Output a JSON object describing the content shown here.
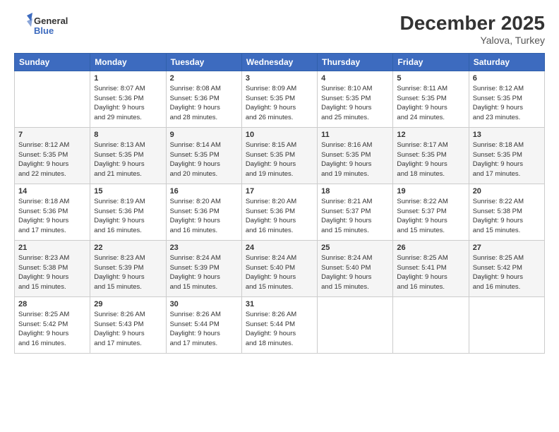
{
  "header": {
    "logo_line1": "General",
    "logo_line2": "Blue",
    "month_title": "December 2025",
    "location": "Yalova, Turkey"
  },
  "weekdays": [
    "Sunday",
    "Monday",
    "Tuesday",
    "Wednesday",
    "Thursday",
    "Friday",
    "Saturday"
  ],
  "weeks": [
    [
      {
        "day": "",
        "info": ""
      },
      {
        "day": "1",
        "info": "Sunrise: 8:07 AM\nSunset: 5:36 PM\nDaylight: 9 hours\nand 29 minutes."
      },
      {
        "day": "2",
        "info": "Sunrise: 8:08 AM\nSunset: 5:36 PM\nDaylight: 9 hours\nand 28 minutes."
      },
      {
        "day": "3",
        "info": "Sunrise: 8:09 AM\nSunset: 5:35 PM\nDaylight: 9 hours\nand 26 minutes."
      },
      {
        "day": "4",
        "info": "Sunrise: 8:10 AM\nSunset: 5:35 PM\nDaylight: 9 hours\nand 25 minutes."
      },
      {
        "day": "5",
        "info": "Sunrise: 8:11 AM\nSunset: 5:35 PM\nDaylight: 9 hours\nand 24 minutes."
      },
      {
        "day": "6",
        "info": "Sunrise: 8:12 AM\nSunset: 5:35 PM\nDaylight: 9 hours\nand 23 minutes."
      }
    ],
    [
      {
        "day": "7",
        "info": "Sunrise: 8:12 AM\nSunset: 5:35 PM\nDaylight: 9 hours\nand 22 minutes."
      },
      {
        "day": "8",
        "info": "Sunrise: 8:13 AM\nSunset: 5:35 PM\nDaylight: 9 hours\nand 21 minutes."
      },
      {
        "day": "9",
        "info": "Sunrise: 8:14 AM\nSunset: 5:35 PM\nDaylight: 9 hours\nand 20 minutes."
      },
      {
        "day": "10",
        "info": "Sunrise: 8:15 AM\nSunset: 5:35 PM\nDaylight: 9 hours\nand 19 minutes."
      },
      {
        "day": "11",
        "info": "Sunrise: 8:16 AM\nSunset: 5:35 PM\nDaylight: 9 hours\nand 19 minutes."
      },
      {
        "day": "12",
        "info": "Sunrise: 8:17 AM\nSunset: 5:35 PM\nDaylight: 9 hours\nand 18 minutes."
      },
      {
        "day": "13",
        "info": "Sunrise: 8:18 AM\nSunset: 5:35 PM\nDaylight: 9 hours\nand 17 minutes."
      }
    ],
    [
      {
        "day": "14",
        "info": "Sunrise: 8:18 AM\nSunset: 5:36 PM\nDaylight: 9 hours\nand 17 minutes."
      },
      {
        "day": "15",
        "info": "Sunrise: 8:19 AM\nSunset: 5:36 PM\nDaylight: 9 hours\nand 16 minutes."
      },
      {
        "day": "16",
        "info": "Sunrise: 8:20 AM\nSunset: 5:36 PM\nDaylight: 9 hours\nand 16 minutes."
      },
      {
        "day": "17",
        "info": "Sunrise: 8:20 AM\nSunset: 5:36 PM\nDaylight: 9 hours\nand 16 minutes."
      },
      {
        "day": "18",
        "info": "Sunrise: 8:21 AM\nSunset: 5:37 PM\nDaylight: 9 hours\nand 15 minutes."
      },
      {
        "day": "19",
        "info": "Sunrise: 8:22 AM\nSunset: 5:37 PM\nDaylight: 9 hours\nand 15 minutes."
      },
      {
        "day": "20",
        "info": "Sunrise: 8:22 AM\nSunset: 5:38 PM\nDaylight: 9 hours\nand 15 minutes."
      }
    ],
    [
      {
        "day": "21",
        "info": "Sunrise: 8:23 AM\nSunset: 5:38 PM\nDaylight: 9 hours\nand 15 minutes."
      },
      {
        "day": "22",
        "info": "Sunrise: 8:23 AM\nSunset: 5:39 PM\nDaylight: 9 hours\nand 15 minutes."
      },
      {
        "day": "23",
        "info": "Sunrise: 8:24 AM\nSunset: 5:39 PM\nDaylight: 9 hours\nand 15 minutes."
      },
      {
        "day": "24",
        "info": "Sunrise: 8:24 AM\nSunset: 5:40 PM\nDaylight: 9 hours\nand 15 minutes."
      },
      {
        "day": "25",
        "info": "Sunrise: 8:24 AM\nSunset: 5:40 PM\nDaylight: 9 hours\nand 15 minutes."
      },
      {
        "day": "26",
        "info": "Sunrise: 8:25 AM\nSunset: 5:41 PM\nDaylight: 9 hours\nand 16 minutes."
      },
      {
        "day": "27",
        "info": "Sunrise: 8:25 AM\nSunset: 5:42 PM\nDaylight: 9 hours\nand 16 minutes."
      }
    ],
    [
      {
        "day": "28",
        "info": "Sunrise: 8:25 AM\nSunset: 5:42 PM\nDaylight: 9 hours\nand 16 minutes."
      },
      {
        "day": "29",
        "info": "Sunrise: 8:26 AM\nSunset: 5:43 PM\nDaylight: 9 hours\nand 17 minutes."
      },
      {
        "day": "30",
        "info": "Sunrise: 8:26 AM\nSunset: 5:44 PM\nDaylight: 9 hours\nand 17 minutes."
      },
      {
        "day": "31",
        "info": "Sunrise: 8:26 AM\nSunset: 5:44 PM\nDaylight: 9 hours\nand 18 minutes."
      },
      {
        "day": "",
        "info": ""
      },
      {
        "day": "",
        "info": ""
      },
      {
        "day": "",
        "info": ""
      }
    ]
  ]
}
